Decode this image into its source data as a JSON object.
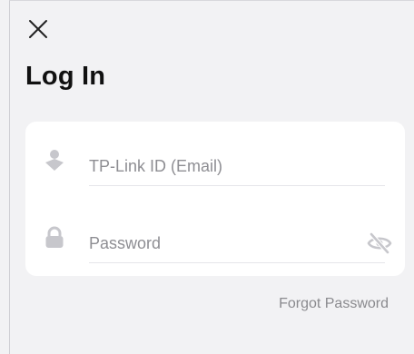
{
  "header": {
    "close_icon": "close-icon",
    "title": "Log In"
  },
  "form": {
    "email": {
      "placeholder": "TP-Link ID (Email)",
      "value": "",
      "icon": "user-icon"
    },
    "password": {
      "placeholder": "Password",
      "value": "",
      "icon": "lock-icon",
      "toggle_icon": "eye-slash-icon"
    }
  },
  "links": {
    "forgot_password": "Forgot Password"
  },
  "colors": {
    "background": "#f2f2f4",
    "card": "#ffffff",
    "icon": "#c7c7cc",
    "placeholder": "#8e8e93",
    "link": "#8a8a8e",
    "title": "#111111"
  }
}
